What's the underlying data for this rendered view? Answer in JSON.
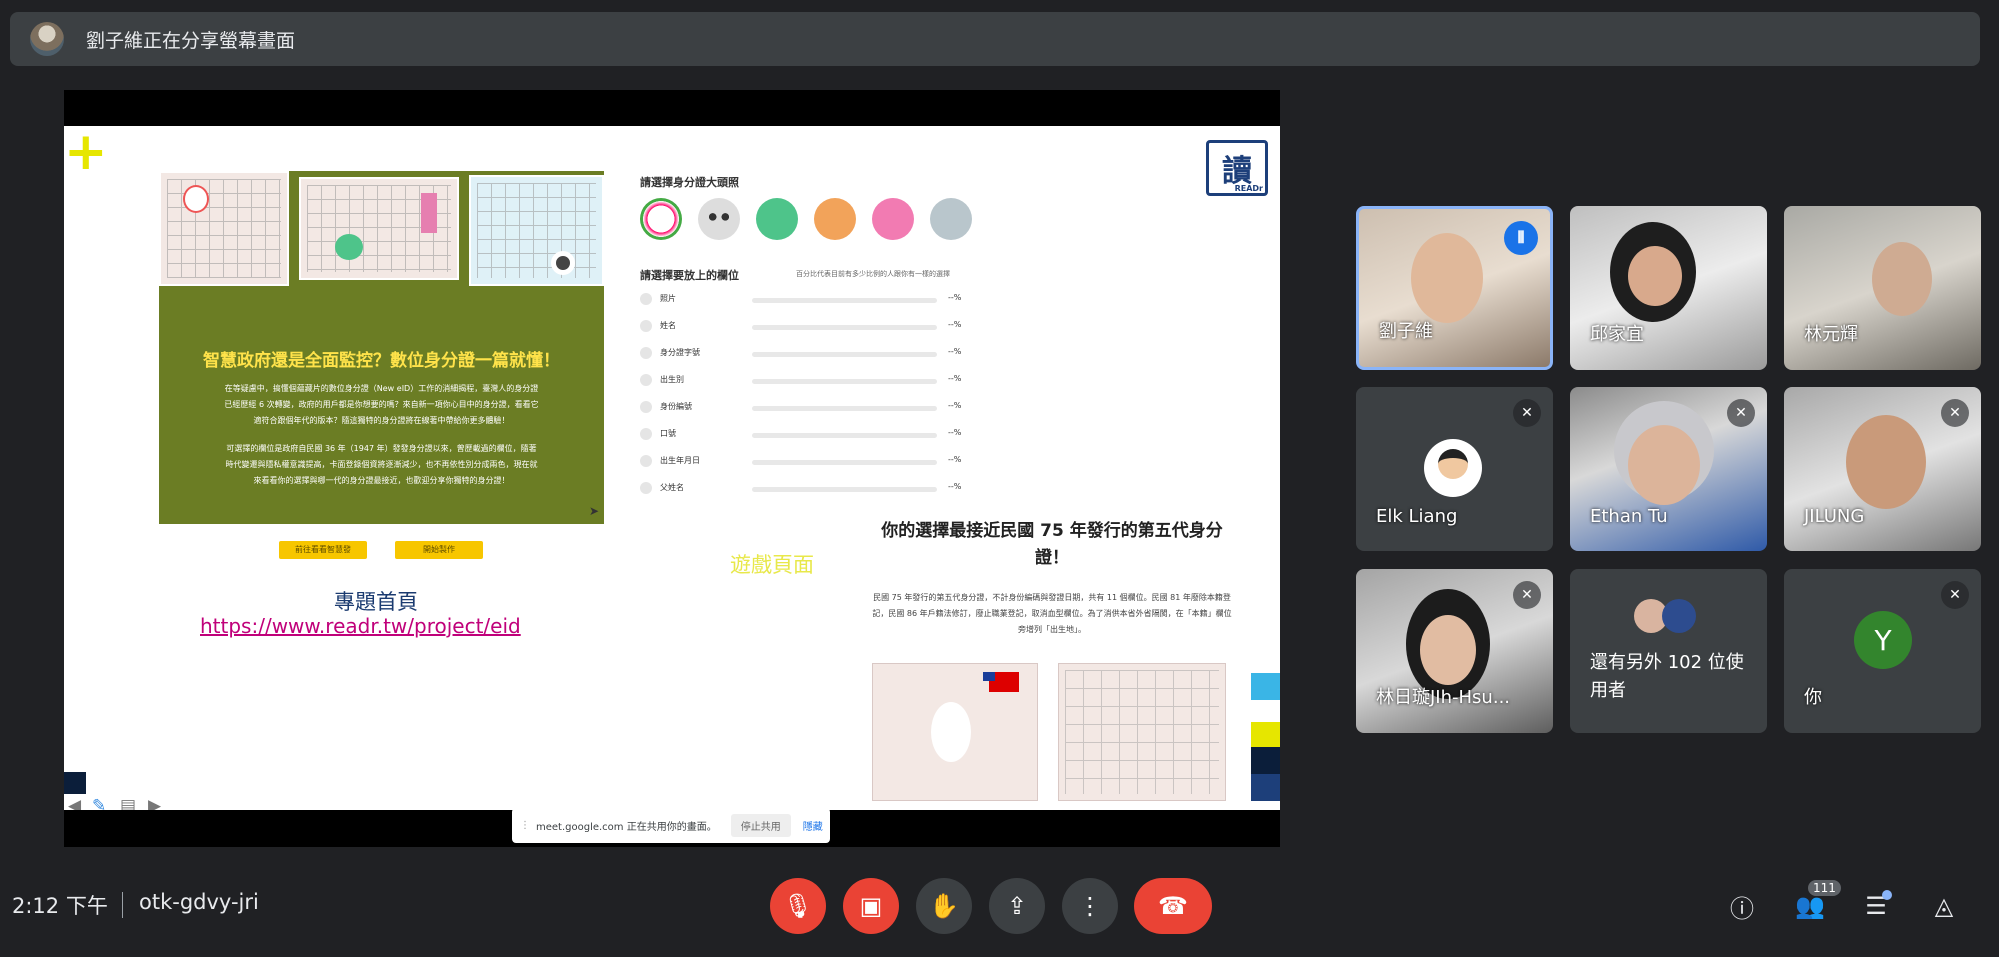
{
  "banner": {
    "text": "劉子維正在分享螢幕畫面"
  },
  "slide": {
    "green_title": "智慧政府還是全面監控？數位身分證一篇就懂！",
    "green_body_1": "在等疑慮中，搞懂個蘊藏片的數位身分證（New eID）工作的消細揭程，臺灣人的身分證已經歷經 6 次轉變，政府的用戶都是你想要的嗎？來自新一項你心目中的身分證，看看它適符合跟個年代的版本？隨這獨特的身分證將在線著中帶給你更多體驗！",
    "green_body_2": "可選擇的欄位是政府自民國 36 年（1947 年）發發身分證以來，曾歷載過的欄位，隨著時代變遷與隱私權意識提高，卡面登錄個資將逐漸減少，也不再依性別分成兩色，現在就來看看你的選擇與哪一代的身分證最接近，也歡迎分享你獨特的身分證！",
    "btn_1": "前往看看智慧發",
    "btn_2": "開始製作",
    "q1": "請選擇身分證大頭照",
    "q2": "請選擇要放上的欄位",
    "q2_note": "百分比代表目前有多少比例的人跟你有一樣的選擇",
    "fields": [
      {
        "label": "照片",
        "pct": "--%"
      },
      {
        "label": "姓名",
        "pct": "--%"
      },
      {
        "label": "身分證字號",
        "pct": "--%"
      },
      {
        "label": "出生別",
        "pct": "--%"
      },
      {
        "label": "身份編號",
        "pct": "--%"
      },
      {
        "label": "口號",
        "pct": "--%"
      },
      {
        "label": "出生年月日",
        "pct": "--%"
      },
      {
        "label": "父姓名",
        "pct": "--%"
      }
    ],
    "result_title": "你的選擇最接近民國 75 年發行的第五代身分證！",
    "result_body": "民國 75 年發行的第五代身分證，不計身份編碼與發證日期，共有 11 個欄位。民國 81 年廢除本籍登記，民國 86 年戶籍法修訂，廢止職業登記，取消血型欄位。為了消供本省外省隔閡，在「本籍」欄位旁增列「出生地」。",
    "game_label": "遊戲頁面",
    "topic_label": "專題首頁",
    "topic_url": "https://www.readr.tw/project/eid",
    "logo_text": "讀",
    "logo_sub": "READr"
  },
  "toast": {
    "text": "meet.google.com 正在共用你的畫面。",
    "stop": "停止共用",
    "hide": "隱藏"
  },
  "participants": [
    {
      "name": "劉子維"
    },
    {
      "name": "邱家宜"
    },
    {
      "name": "林元輝"
    },
    {
      "name": "Elk Liang"
    },
    {
      "name": "Ethan Tu"
    },
    {
      "name": "JILUNG"
    },
    {
      "name": "林日璇JIh-Hsu..."
    },
    {
      "name": "還有另外 102 位使用者"
    },
    {
      "name": "你",
      "initial": "Y"
    }
  ],
  "bottom": {
    "time": "2:12 下午",
    "meeting_code": "otk-gdvy-jri",
    "people_count": "111"
  }
}
